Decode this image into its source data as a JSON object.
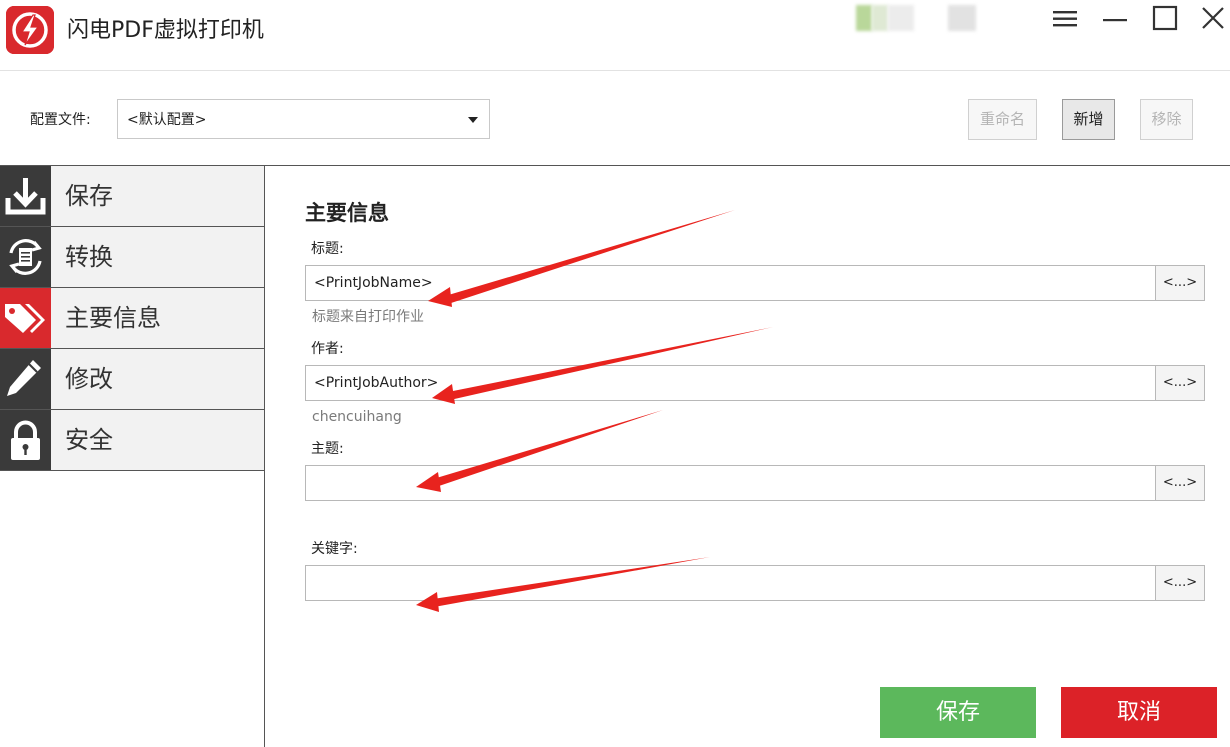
{
  "app": {
    "title": "闪电PDF虚拟打印机"
  },
  "window_controls": {
    "menu_icon": "hamburger-menu-icon",
    "minimize_icon": "minimize-icon",
    "maximize_icon": "maximize-icon",
    "close_icon": "close-icon"
  },
  "config": {
    "label": "配置文件:",
    "selected_value": "<默认配置>",
    "buttons": {
      "rename": "重命名",
      "add": "新增",
      "remove": "移除"
    }
  },
  "sidebar": {
    "items": [
      {
        "label": "保存",
        "icon": "download-icon",
        "active": false
      },
      {
        "label": "转换",
        "icon": "convert-icon",
        "active": false
      },
      {
        "label": "主要信息",
        "icon": "tags-icon",
        "active": true
      },
      {
        "label": "修改",
        "icon": "pencil-icon",
        "active": false
      },
      {
        "label": "安全",
        "icon": "lock-icon",
        "active": false
      }
    ]
  },
  "main": {
    "section_title": "主要信息",
    "fields": [
      {
        "label": "标题:",
        "value": "<PrintJobName>",
        "button": "<...>",
        "hint": "标题来自打印作业"
      },
      {
        "label": "作者:",
        "value": "<PrintJobAuthor>",
        "button": "<...>",
        "hint": "chencuihang"
      },
      {
        "label": "主题:",
        "value": "",
        "button": "<...>",
        "hint": ""
      },
      {
        "label": "关键字:",
        "value": "",
        "button": "<...>",
        "hint": ""
      }
    ]
  },
  "footer": {
    "save_label": "保存",
    "cancel_label": "取消"
  },
  "colors": {
    "brand_red": "#d9292d",
    "save_green": "#5cb85c",
    "cancel_red": "#dc2228",
    "sidebar_dark": "#3a3a3a",
    "annotation_arrow": "#e8231e"
  }
}
